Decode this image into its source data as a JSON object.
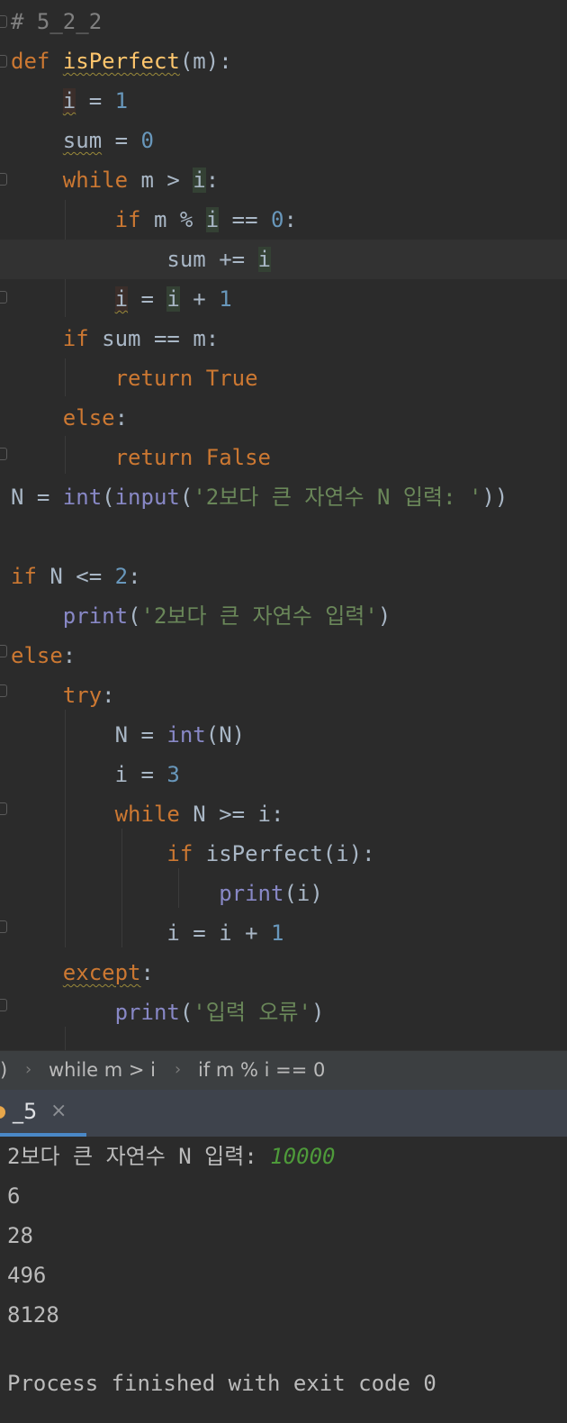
{
  "editor": {
    "comment": "# 5_2_2",
    "code": {
      "def": "def",
      "func_name": "isPerfect",
      "param": "(m):",
      "i_var": "i",
      "eq": " = ",
      "one": "1",
      "sum_var": "sum",
      "zero": "0",
      "while": "while",
      "if": "if",
      "else": "else",
      "try": "try",
      "except": "except",
      "return": "return",
      "true": "True",
      "false": "False",
      "int": "int",
      "input": "input",
      "print": "print",
      "two": "2",
      "three": "3",
      "prompt_str": "'2보다 큰 자연수 N 입력: '",
      "warn_str": "'2보다 큰 자연수 입력'",
      "err_str": "'입력 오류'"
    }
  },
  "breadcrumb": {
    "item0": ")",
    "item1": "while m > i",
    "item2": "if m % i == 0"
  },
  "run_panel": {
    "tab_label": "_5",
    "close_glyph": "×"
  },
  "console": {
    "prompt": "2보다 큰 자연수 N 입력: ",
    "user_input": "10000",
    "outputs": [
      "6",
      "28",
      "496",
      "8128"
    ],
    "exit_message": "Process finished with exit code 0"
  },
  "colors": {
    "keyword": "#cc7832",
    "number": "#6897bb",
    "string": "#6a8759",
    "builtin": "#8888c6",
    "function": "#ffc66d",
    "user_input": "#4e9a3a",
    "tab_underline": "#4a88c7"
  }
}
